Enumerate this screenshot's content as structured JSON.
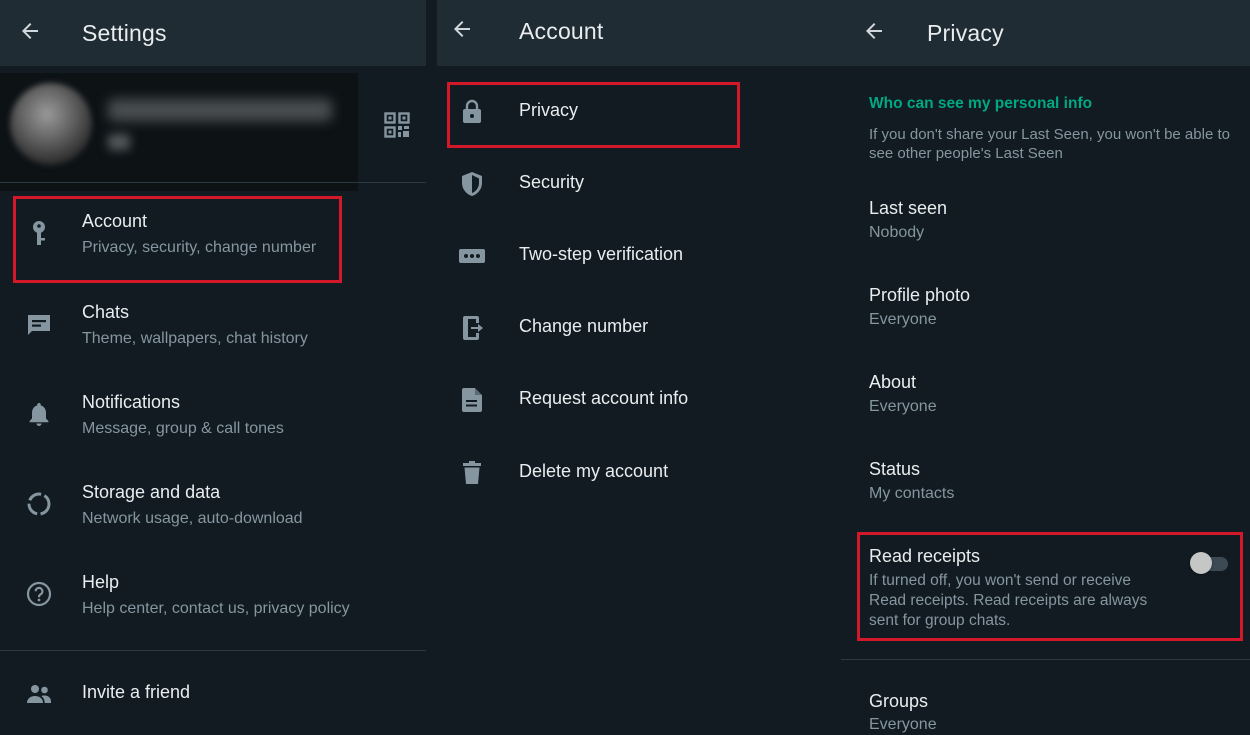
{
  "settings": {
    "title": "Settings",
    "items": [
      {
        "label": "Account",
        "sub": "Privacy, security, change number",
        "icon": "key-icon"
      },
      {
        "label": "Chats",
        "sub": "Theme, wallpapers, chat history",
        "icon": "chat-icon"
      },
      {
        "label": "Notifications",
        "sub": "Message, group & call tones",
        "icon": "bell-icon"
      },
      {
        "label": "Storage and data",
        "sub": "Network usage, auto-download",
        "icon": "storage-icon"
      },
      {
        "label": "Help",
        "sub": "Help center, contact us, privacy policy",
        "icon": "help-icon"
      },
      {
        "label": "Invite a friend",
        "icon": "people-icon"
      }
    ]
  },
  "account": {
    "title": "Account",
    "items": [
      {
        "label": "Privacy",
        "icon": "lock-icon"
      },
      {
        "label": "Security",
        "icon": "shield-icon"
      },
      {
        "label": "Two-step verification",
        "icon": "dots-icon"
      },
      {
        "label": "Change number",
        "icon": "change-number-icon"
      },
      {
        "label": "Request account info",
        "icon": "document-icon"
      },
      {
        "label": "Delete my account",
        "icon": "trash-icon"
      }
    ]
  },
  "privacy": {
    "title": "Privacy",
    "section_header": "Who can see my personal info",
    "section_desc": [
      "If you don't share your Last Seen, you won't be able to",
      "see other people's Last Seen"
    ],
    "items": [
      {
        "label": "Last seen",
        "value": "Nobody"
      },
      {
        "label": "Profile photo",
        "value": "Everyone"
      },
      {
        "label": "About",
        "value": "Everyone"
      },
      {
        "label": "Status",
        "value": "My contacts"
      }
    ],
    "read_receipts": {
      "label": "Read receipts",
      "desc": [
        "If turned off, you won't send or receive",
        "Read receipts. Read receipts are always",
        "sent for group chats."
      ],
      "enabled": false
    },
    "groups": {
      "label": "Groups",
      "value": "Everyone"
    }
  },
  "colors": {
    "background": "#111b21",
    "topbar": "#202c33",
    "accent": "#00a884",
    "highlight": "#d3182a",
    "secondary_text": "#8696a0"
  }
}
